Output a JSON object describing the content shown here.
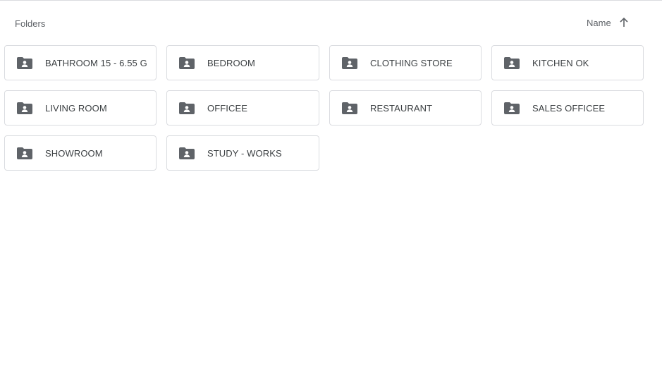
{
  "section": {
    "title": "Folders"
  },
  "sort": {
    "label": "Name",
    "direction_icon": "arrow-up-icon"
  },
  "colors": {
    "folder_icon": "#5f6368",
    "card_border": "#dadce0",
    "text": "#3c4043",
    "muted_text": "#5f6368"
  },
  "folders": [
    {
      "name": "BATHROOM 15 - 6.55 G",
      "icon": "shared-folder-icon"
    },
    {
      "name": "BEDROOM",
      "icon": "shared-folder-icon"
    },
    {
      "name": "CLOTHING STORE",
      "icon": "shared-folder-icon"
    },
    {
      "name": "KITCHEN OK",
      "icon": "shared-folder-icon"
    },
    {
      "name": "LIVING ROOM",
      "icon": "shared-folder-icon"
    },
    {
      "name": "OFFICEE",
      "icon": "shared-folder-icon"
    },
    {
      "name": "RESTAURANT",
      "icon": "shared-folder-icon"
    },
    {
      "name": "SALES OFFICEE",
      "icon": "shared-folder-icon"
    },
    {
      "name": "SHOWROOM",
      "icon": "shared-folder-icon"
    },
    {
      "name": "STUDY - WORKS",
      "icon": "shared-folder-icon"
    }
  ]
}
